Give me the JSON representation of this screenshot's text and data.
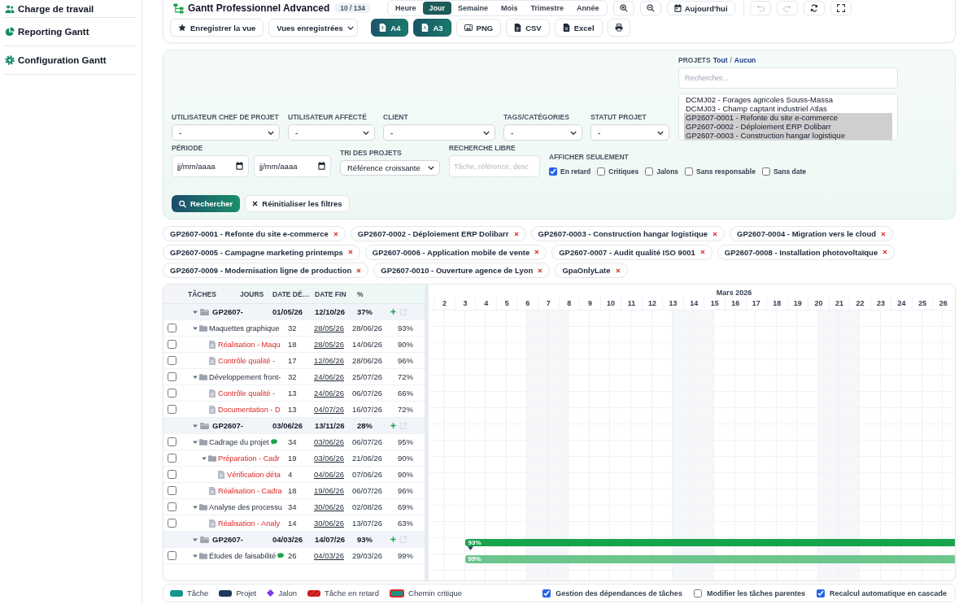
{
  "sidebar": {
    "items": [
      {
        "label": "Charge de travail"
      },
      {
        "label": "Reporting Gantt"
      },
      {
        "label": "Configuration Gantt"
      }
    ]
  },
  "header": {
    "title": "Gantt Professionnel Advanced",
    "count": "10 / 134",
    "views": [
      {
        "label": "Heure",
        "selected": false
      },
      {
        "label": "Jour",
        "selected": true
      },
      {
        "label": "Semaine",
        "selected": false
      },
      {
        "label": "Mois",
        "selected": false
      },
      {
        "label": "Trimestre",
        "selected": false
      },
      {
        "label": "Année",
        "selected": false
      }
    ],
    "today": "Aujourd'hui",
    "undo": {
      "disabled": true
    },
    "redo": {
      "disabled": true
    },
    "save_view": "Enregistrer la vue",
    "saved_views": {
      "value": "Vues enregistrées"
    },
    "exports": [
      {
        "label": "A4",
        "kind": "pdf"
      },
      {
        "label": "A3",
        "kind": "pdf"
      },
      {
        "label": "PNG",
        "kind": "image"
      },
      {
        "label": "CSV",
        "kind": "csv"
      },
      {
        "label": "Excel",
        "kind": "excel"
      }
    ]
  },
  "filters": {
    "selects": [
      {
        "label": "UTILISATEUR CHEF DE PROJET",
        "value": "-"
      },
      {
        "label": "UTILISATEUR AFFECTÉ",
        "value": "-"
      },
      {
        "label": "CLIENT",
        "value": "-"
      },
      {
        "label": "TAGS/CATÉGORIES",
        "value": "-"
      },
      {
        "label": "STATUT PROJET",
        "value": "-"
      }
    ],
    "projects": {
      "label": "PROJETS",
      "all": "Tout",
      "separator": "/",
      "none": "Aucun",
      "search": {
        "placeholder": "Rechercher..."
      },
      "options": [
        {
          "label": "DCMJ02 - Forages agricoles Souss-Massa",
          "selected": false
        },
        {
          "label": "DCMJ03 - Champ captant industriel Atlas",
          "selected": false
        },
        {
          "label": "GP2607-0001 - Refonte du site e-commerce",
          "selected": true
        },
        {
          "label": "GP2607-0002 - Déploiement ERP Dolibarr",
          "selected": true
        },
        {
          "label": "GP2607-0003 - Construction hangar logistique",
          "selected": true
        }
      ]
    },
    "period": {
      "label": "PÉRIODE",
      "fields": [
        {
          "placeholder": "jj/mm/aaaa"
        },
        {
          "placeholder": "jj/mm/aaaa"
        }
      ]
    },
    "sort": {
      "label": "TRI DES PROJETS",
      "value": "Référence croissante"
    },
    "free_search": {
      "label": "RECHERCHE LIBRE",
      "placeholder": "Tâche, référence, desc"
    },
    "show_only": {
      "label": "AFFICHER SEULEMENT",
      "options": [
        {
          "label": "En retard",
          "checked": true
        },
        {
          "label": "Critiques",
          "checked": false
        },
        {
          "label": "Jalons",
          "checked": false
        },
        {
          "label": "Sans responsable",
          "checked": false
        },
        {
          "label": "Sans date",
          "checked": false
        }
      ]
    },
    "search_button": "Rechercher",
    "reset_button": "Réinitialiser les filtres"
  },
  "chips": [
    "GP2607-0001 - Refonte du site e-commerce",
    "GP2607-0002 - Déploiement ERP Dolibarr",
    "GP2607-0003 - Construction hangar logistique",
    "GP2607-0004 - Migration vers le cloud",
    "GP2607-0005 - Campagne marketing printemps",
    "GP2607-0006 - Application mobile de vente",
    "GP2607-0007 - Audit qualité ISO 9001",
    "GP2607-0008 - Installation photovoltaïque",
    "GP2607-0009 - Modernisation ligne de production",
    "GP2607-0010 - Ouverture agence de Lyon",
    "GpaOnlyLate"
  ],
  "task_table": {
    "columns": [
      "TÂCHES",
      "JOURS",
      "DATE DÉ…",
      "DATE FIN",
      "%"
    ],
    "projects": [
      {
        "name": "GP2607-",
        "start": "01/05/26",
        "end": "12/10/26",
        "progress": "37%",
        "expanded": true,
        "children": [
          {
            "name": "Maquettes graphique",
            "days": "32",
            "start": "28/05/26",
            "end": "28/06/26",
            "progress": "93%",
            "kind": "folder",
            "expanded": true,
            "checked": false,
            "late": false,
            "comment": false,
            "children": [
              {
                "name": "Réalisation - Maqu",
                "days": "18",
                "start": "28/05/26",
                "end": "14/06/26",
                "progress": "90%",
                "kind": "file",
                "checked": false,
                "late": true,
                "comment": false
              },
              {
                "name": "Contrôle qualité -",
                "days": "17",
                "start": "12/06/26",
                "end": "28/06/26",
                "progress": "96%",
                "kind": "file",
                "checked": false,
                "late": true,
                "comment": false
              }
            ]
          },
          {
            "name": "Développement front-",
            "days": "32",
            "start": "24/06/26",
            "end": "25/07/26",
            "progress": "72%",
            "kind": "folder",
            "expanded": true,
            "checked": false,
            "late": false,
            "comment": false,
            "children": [
              {
                "name": "Contrôle qualité -",
                "days": "13",
                "start": "24/06/26",
                "end": "06/07/26",
                "progress": "66%",
                "kind": "file",
                "checked": false,
                "late": true,
                "comment": false
              },
              {
                "name": "Documentation - D",
                "days": "13",
                "start": "04/07/26",
                "end": "16/07/26",
                "progress": "72%",
                "kind": "file",
                "checked": false,
                "late": true,
                "comment": false
              }
            ]
          }
        ]
      },
      {
        "name": "GP2607-",
        "start": "03/06/26",
        "end": "13/11/26",
        "progress": "28%",
        "expanded": true,
        "children": [
          {
            "name": "Cadrage du projet",
            "days": "34",
            "start": "03/06/26",
            "end": "06/07/26",
            "progress": "95%",
            "kind": "folder",
            "expanded": true,
            "checked": false,
            "late": false,
            "comment": true,
            "children": [
              {
                "name": "Préparation - Cadr",
                "days": "19",
                "start": "03/06/26",
                "end": "21/06/26",
                "progress": "90%",
                "kind": "folder",
                "expanded": true,
                "checked": false,
                "late": true,
                "comment": false,
                "children": [
                  {
                    "name": "Vérification déta",
                    "days": "4",
                    "start": "04/06/26",
                    "end": "07/06/26",
                    "progress": "90%",
                    "kind": "file",
                    "checked": false,
                    "late": true,
                    "comment": false
                  }
                ]
              },
              {
                "name": "Réalisation - Cadra",
                "days": "18",
                "start": "19/06/26",
                "end": "06/07/26",
                "progress": "96%",
                "kind": "file",
                "checked": false,
                "late": true,
                "comment": false
              }
            ]
          },
          {
            "name": "Analyse des processu",
            "days": "34",
            "start": "30/06/26",
            "end": "02/08/26",
            "progress": "69%",
            "kind": "folder",
            "expanded": true,
            "checked": false,
            "late": false,
            "comment": false,
            "children": [
              {
                "name": "Réalisation - Analy",
                "days": "14",
                "start": "30/06/26",
                "end": "13/07/26",
                "progress": "63%",
                "kind": "file",
                "checked": false,
                "late": true,
                "comment": false
              }
            ]
          }
        ]
      },
      {
        "name": "GP2607-",
        "start": "04/03/26",
        "end": "14/07/26",
        "progress": "93%",
        "expanded": true,
        "bar": {
          "label": "93%",
          "kind": "project"
        },
        "children": [
          {
            "name": "Études de faisabilité",
            "days": "26",
            "start": "04/03/26",
            "end": "29/03/26",
            "progress": "99%",
            "kind": "folder",
            "expanded": true,
            "checked": false,
            "late": false,
            "comment": true,
            "bar": {
              "label": "99%",
              "kind": "task"
            }
          }
        ]
      }
    ]
  },
  "timeline": {
    "month": "Mars 2026",
    "days": [
      {
        "label": "2",
        "weekend": false
      },
      {
        "label": "3",
        "weekend": false
      },
      {
        "label": "4",
        "weekend": false
      },
      {
        "label": "5",
        "weekend": false
      },
      {
        "label": "6",
        "weekend": false
      },
      {
        "label": "7",
        "weekend": true
      },
      {
        "label": "8",
        "weekend": true
      },
      {
        "label": "9",
        "weekend": false
      },
      {
        "label": "10",
        "weekend": false
      },
      {
        "label": "11",
        "weekend": false
      },
      {
        "label": "12",
        "weekend": false
      },
      {
        "label": "13",
        "weekend": false
      },
      {
        "label": "14",
        "weekend": true
      },
      {
        "label": "15",
        "weekend": true
      },
      {
        "label": "16",
        "weekend": false
      },
      {
        "label": "17",
        "weekend": false
      },
      {
        "label": "18",
        "weekend": false
      },
      {
        "label": "19",
        "weekend": false
      },
      {
        "label": "20",
        "weekend": false
      },
      {
        "label": "21",
        "weekend": true
      },
      {
        "label": "22",
        "weekend": true
      },
      {
        "label": "23",
        "weekend": false
      },
      {
        "label": "24",
        "weekend": false
      },
      {
        "label": "25",
        "weekend": false
      },
      {
        "label": "26",
        "weekend": false
      }
    ]
  },
  "legend": {
    "items": [
      {
        "label": "Tâche",
        "kind": "task"
      },
      {
        "label": "Projet",
        "kind": "project"
      },
      {
        "label": "Jalon",
        "kind": "milestone"
      },
      {
        "label": "Tâche en retard",
        "kind": "late"
      },
      {
        "label": "Chemin critique",
        "kind": "critical"
      }
    ],
    "options": [
      {
        "label": "Gestion des dépendances de tâches",
        "checked": true
      },
      {
        "label": "Modifier les tâches parentes",
        "checked": false
      },
      {
        "label": "Recalcul automatique en cascade",
        "checked": true
      }
    ]
  }
}
